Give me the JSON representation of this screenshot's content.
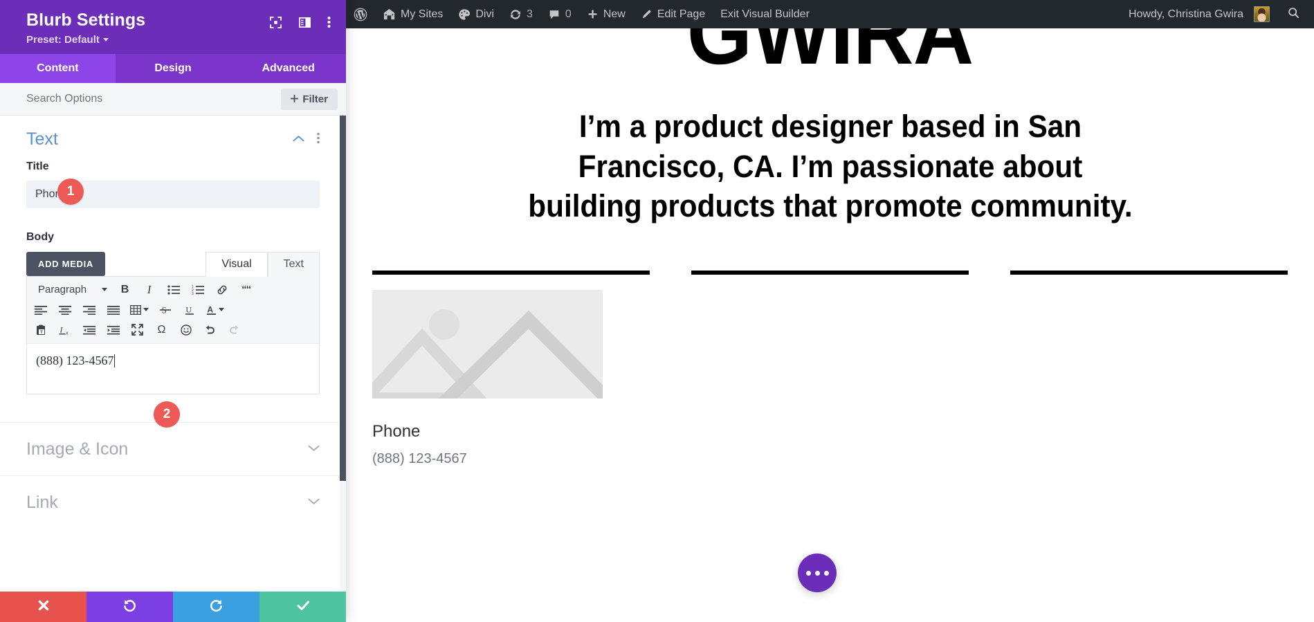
{
  "adminbar": {
    "items": [
      {
        "icon": "wordpress-logo-icon",
        "label": ""
      },
      {
        "icon": "my-sites-icon",
        "label": "My Sites"
      },
      {
        "icon": "divi-palette-icon",
        "label": "Divi"
      },
      {
        "icon": "updates-icon",
        "label": "3"
      },
      {
        "icon": "comments-icon",
        "label": "0"
      },
      {
        "icon": "plus-icon",
        "label": "New"
      },
      {
        "icon": "pencil-icon",
        "label": "Edit Page"
      },
      {
        "icon": "",
        "label": "Exit Visual Builder"
      }
    ],
    "howdy": "Howdy, Christina Gwira",
    "search_icon": "search-icon"
  },
  "panel": {
    "title": "Blurb Settings",
    "preset": "Preset: Default",
    "header_icons": [
      "focus-module-icon",
      "panel-layout-icon",
      "kebab-menu-icon"
    ],
    "tabs": [
      {
        "label": "Content",
        "active": true
      },
      {
        "label": "Design",
        "active": false
      },
      {
        "label": "Advanced",
        "active": false
      }
    ],
    "search_placeholder": "Search Options",
    "filter_label": "Filter",
    "text_section": {
      "title": "Text",
      "collapse_icon": "chevron-up-icon",
      "menu_icon": "kebab-menu-icon",
      "title_label": "Title",
      "title_value": "Phone",
      "body_label": "Body",
      "add_media_label": "ADD MEDIA",
      "editor_tabs": [
        {
          "label": "Visual",
          "active": true
        },
        {
          "label": "Text",
          "active": false
        }
      ],
      "toolbar": {
        "format_label": "Paragraph",
        "row1": [
          "bold-icon",
          "italic-icon",
          "bulleted-list-icon",
          "numbered-list-icon",
          "link-icon",
          "blockquote-icon"
        ],
        "row2": [
          "align-left-icon",
          "align-center-icon",
          "align-right-icon",
          "align-justify-icon",
          "table-icon",
          "strikethrough-icon",
          "underline-icon",
          "text-color-icon"
        ],
        "row3": [
          "paste-as-text-icon",
          "clear-formatting-icon",
          "outdent-icon",
          "indent-icon",
          "fullscreen-icon",
          "special-character-icon",
          "emoji-icon",
          "undo-icon",
          "redo-icon"
        ]
      },
      "body_value": "(888) 123-4567"
    },
    "collapsed_sections": [
      {
        "label": "Image & Icon",
        "icon": "chevron-down-icon"
      },
      {
        "label": "Link",
        "icon": "chevron-down-icon"
      }
    ],
    "footer_buttons": [
      {
        "name": "discard-button",
        "icon": "close-icon",
        "color": "#e8534e"
      },
      {
        "name": "undo-button",
        "icon": "undo-icon",
        "color": "#7b3fe4"
      },
      {
        "name": "redo-button",
        "icon": "redo-icon",
        "color": "#3ba0e0"
      },
      {
        "name": "save-button",
        "icon": "check-icon",
        "color": "#4fc4a0"
      }
    ]
  },
  "annotations": [
    {
      "number": "1",
      "target": "title-field"
    },
    {
      "number": "2",
      "target": "body-editor"
    }
  ],
  "page": {
    "hero_name": "GWIRA",
    "hero_subtitle": "I’m a product designer based in San Francisco, CA. I’m passionate about building products that promote community.",
    "blurb": {
      "title": "Phone",
      "body": "(888) 123-4567",
      "image_placeholder": "image-placeholder-icon"
    },
    "fab_icon": "divi-menu-dots-icon"
  },
  "colors": {
    "divi_purple": "#6c2eb9",
    "tab_active": "#8e45e8",
    "badge_red": "#ed5a56",
    "adminbar_dark": "#23282d",
    "section_blue": "#5a8fd6"
  }
}
